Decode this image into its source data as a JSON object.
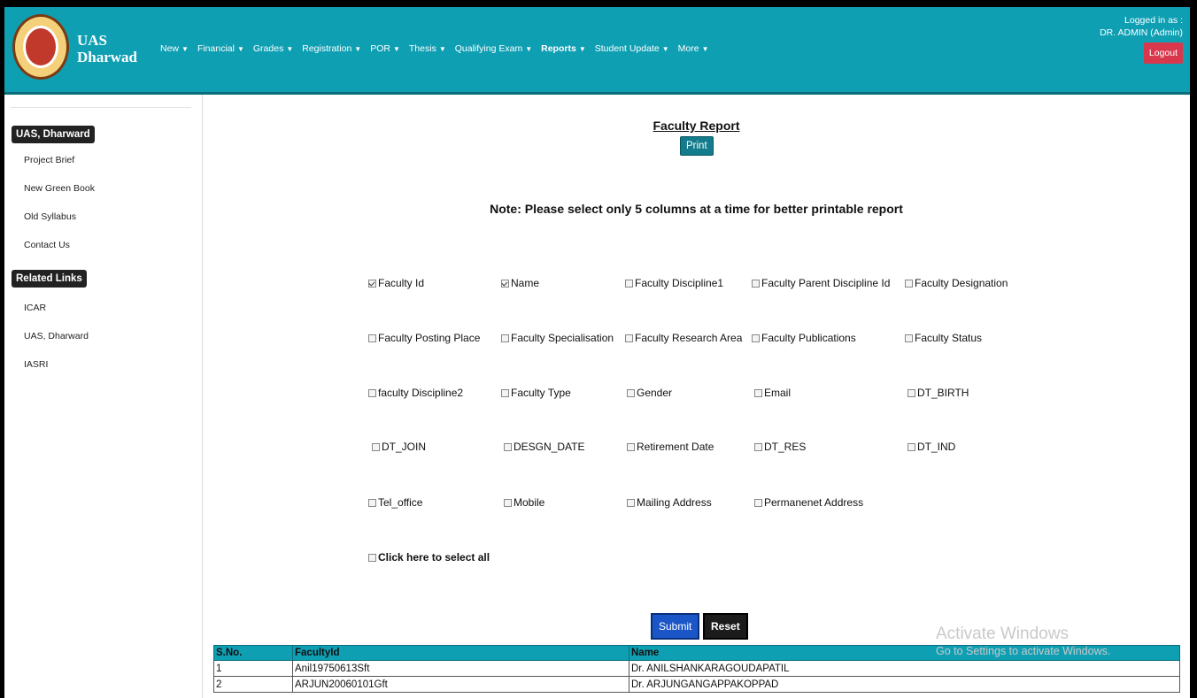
{
  "header": {
    "brand_line1": "UAS",
    "brand_line2": "Dharwad",
    "nav": [
      {
        "label": "New"
      },
      {
        "label": "Financial"
      },
      {
        "label": "Grades"
      },
      {
        "label": "Registration"
      },
      {
        "label": "POR"
      },
      {
        "label": "Thesis"
      },
      {
        "label": "Qualifying Exam"
      },
      {
        "label": "Reports"
      },
      {
        "label": "Student Update"
      },
      {
        "label": "More"
      }
    ],
    "logged_in_label": "Logged in as :",
    "user": "DR. ADMIN (Admin)",
    "logout_label": "Logout"
  },
  "sidebar": {
    "section1": "UAS, Dharward",
    "links1": [
      "Project Brief",
      "New Green Book",
      "Old Syllabus",
      "Contact Us"
    ],
    "section2": "Related Links",
    "links2": [
      "ICAR",
      "UAS, Dharward",
      "IASRI"
    ]
  },
  "main": {
    "title": "Faculty Report",
    "print_label": "Print",
    "note": "Note: Please select only 5 columns at a time for better printable report",
    "checkboxes": [
      {
        "label": "Faculty Id",
        "checked": true
      },
      {
        "label": "Name",
        "checked": true
      },
      {
        "label": "Faculty Discipline1",
        "checked": false
      },
      {
        "label": "Faculty Parent Discipline Id",
        "checked": false
      },
      {
        "label": "Faculty Designation",
        "checked": false
      },
      {
        "label": "Faculty Posting Place",
        "checked": false
      },
      {
        "label": "Faculty Specialisation",
        "checked": false
      },
      {
        "label": "Faculty Research Area",
        "checked": false
      },
      {
        "label": "Faculty Publications",
        "checked": false
      },
      {
        "label": "Faculty Status",
        "checked": false
      },
      {
        "label": "faculty Discipline2",
        "checked": false
      },
      {
        "label": "Faculty Type",
        "checked": false
      },
      {
        "label": "Gender",
        "checked": false
      },
      {
        "label": "Email",
        "checked": false
      },
      {
        "label": "DT_BIRTH",
        "checked": false
      },
      {
        "label": "DT_JOIN",
        "checked": false
      },
      {
        "label": "DESGN_DATE",
        "checked": false
      },
      {
        "label": "Retirement Date",
        "checked": false
      },
      {
        "label": "DT_RES",
        "checked": false
      },
      {
        "label": "DT_IND",
        "checked": false
      },
      {
        "label": "Tel_office",
        "checked": false
      },
      {
        "label": "Mobile",
        "checked": false
      },
      {
        "label": "Mailing Address",
        "checked": false
      },
      {
        "label": "Permanenet Address",
        "checked": false
      }
    ],
    "select_all_label": "Click here to select all",
    "submit_label": "Submit",
    "reset_label": "Reset",
    "table": {
      "headers": [
        "S.No.",
        "FacultyId",
        "Name"
      ],
      "rows": [
        [
          "1",
          "Anil19750613Sft",
          "Dr. ANILSHANKARAGOUDAPATIL"
        ],
        [
          "2",
          "ARJUN20060101Gft",
          "Dr. ARJUNGANGAPPAKOPPAD"
        ]
      ]
    }
  },
  "watermark": {
    "line1": "Activate Windows",
    "line2": "Go to Settings to activate Windows."
  }
}
